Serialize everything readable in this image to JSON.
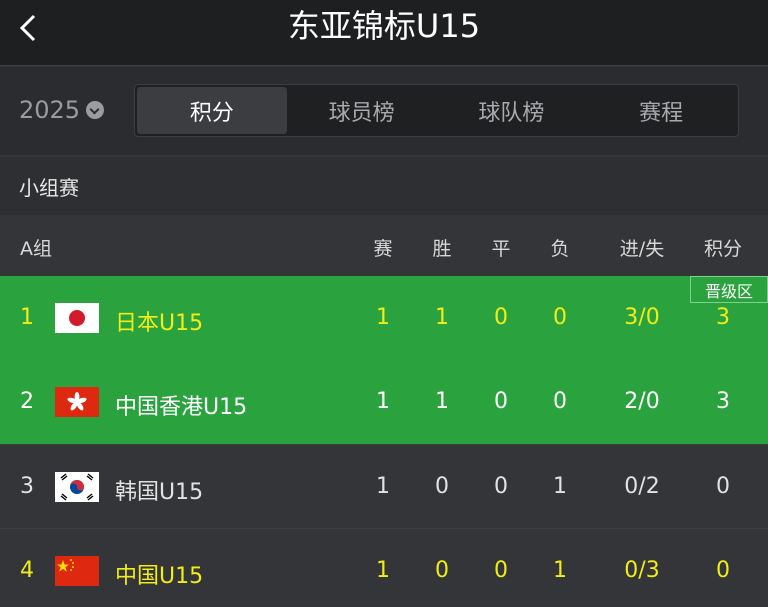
{
  "header": {
    "title": "东亚锦标U15",
    "back_icon": "chevron-left-icon"
  },
  "filter": {
    "year": "2025",
    "year_icon": "chevron-down-circle-icon",
    "tabs": [
      "积分",
      "球员榜",
      "球队榜",
      "赛程"
    ],
    "active_tab": "积分"
  },
  "section_title": "小组赛",
  "table": {
    "group_label": "A组",
    "columns": [
      "赛",
      "胜",
      "平",
      "负",
      "进/失",
      "积分"
    ],
    "qualify_badge": "晋级区",
    "rows": [
      {
        "rank": "1",
        "team": "日本U15",
        "flag": "japan-flag-icon",
        "played": "1",
        "won": "1",
        "drawn": "0",
        "lost": "0",
        "goals": "3/0",
        "points": "3"
      },
      {
        "rank": "2",
        "team": "中国香港U15",
        "flag": "hong-kong-flag-icon",
        "played": "1",
        "won": "1",
        "drawn": "0",
        "lost": "0",
        "goals": "2/0",
        "points": "3"
      },
      {
        "rank": "3",
        "team": "韩国U15",
        "flag": "south-korea-flag-icon",
        "played": "1",
        "won": "0",
        "drawn": "0",
        "lost": "1",
        "goals": "0/2",
        "points": "0"
      },
      {
        "rank": "4",
        "team": "中国U15",
        "flag": "china-flag-icon",
        "played": "1",
        "won": "0",
        "drawn": "0",
        "lost": "1",
        "goals": "0/3",
        "points": "0"
      }
    ]
  },
  "colors": {
    "qualify_zone": "#2aa33e",
    "highlight_text": "#f2ec18",
    "background": "#333538"
  }
}
